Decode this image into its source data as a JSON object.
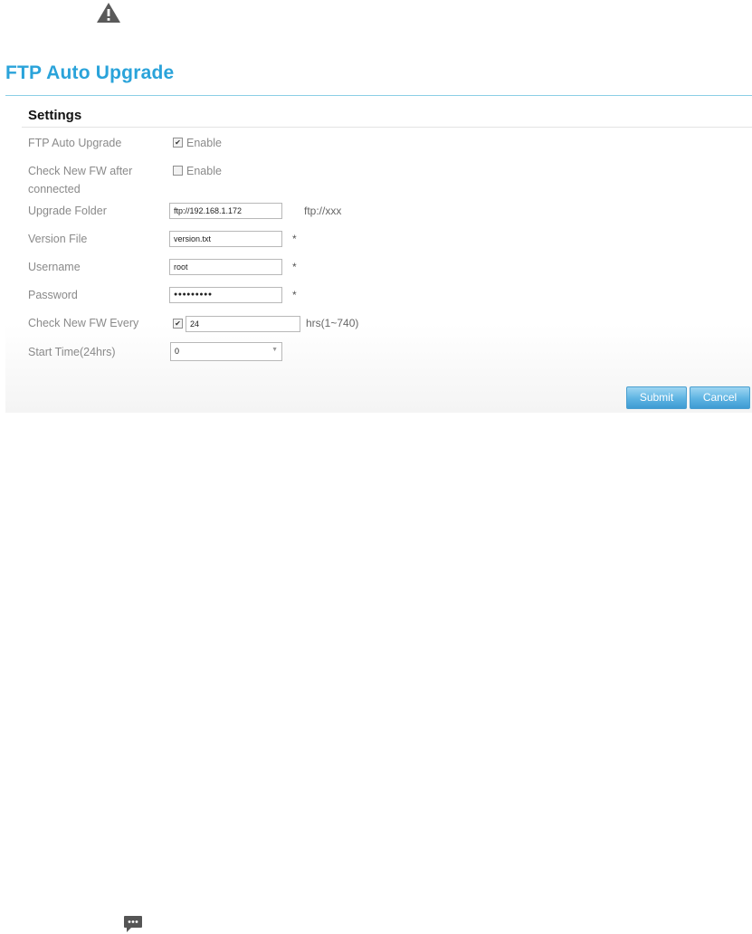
{
  "page": {
    "title": "FTP Auto Upgrade"
  },
  "settings": {
    "heading": "Settings",
    "ftp_auto_upgrade": {
      "label": "FTP Auto Upgrade",
      "checkbox_label": "Enable",
      "checked": true
    },
    "check_fw_after_connected": {
      "label_line1": "Check New FW after",
      "label_line2": "connected",
      "checkbox_label": "Enable",
      "checked": false
    },
    "upgrade_folder": {
      "label": "Upgrade Folder",
      "value": "ftp://192.168.1.172",
      "hint": "ftp://xxx"
    },
    "version_file": {
      "label": "Version File",
      "value": "version.txt",
      "required_mark": "*"
    },
    "username": {
      "label": "Username",
      "value": "root",
      "required_mark": "*"
    },
    "password": {
      "label": "Password",
      "value": "●●●●●●●●●",
      "required_mark": "*"
    },
    "check_every": {
      "label": "Check New FW Every",
      "checked": true,
      "value": "24",
      "unit": "hrs(1~740)"
    },
    "start_time": {
      "label": "Start Time(24hrs)",
      "selected": "0"
    }
  },
  "actions": {
    "submit": "Submit",
    "cancel": "Cancel"
  },
  "icons": {
    "top": "warning-icon",
    "bottom": "chat-icon"
  },
  "colors": {
    "accent": "#2aa3da",
    "button": "#4aa8dc"
  }
}
